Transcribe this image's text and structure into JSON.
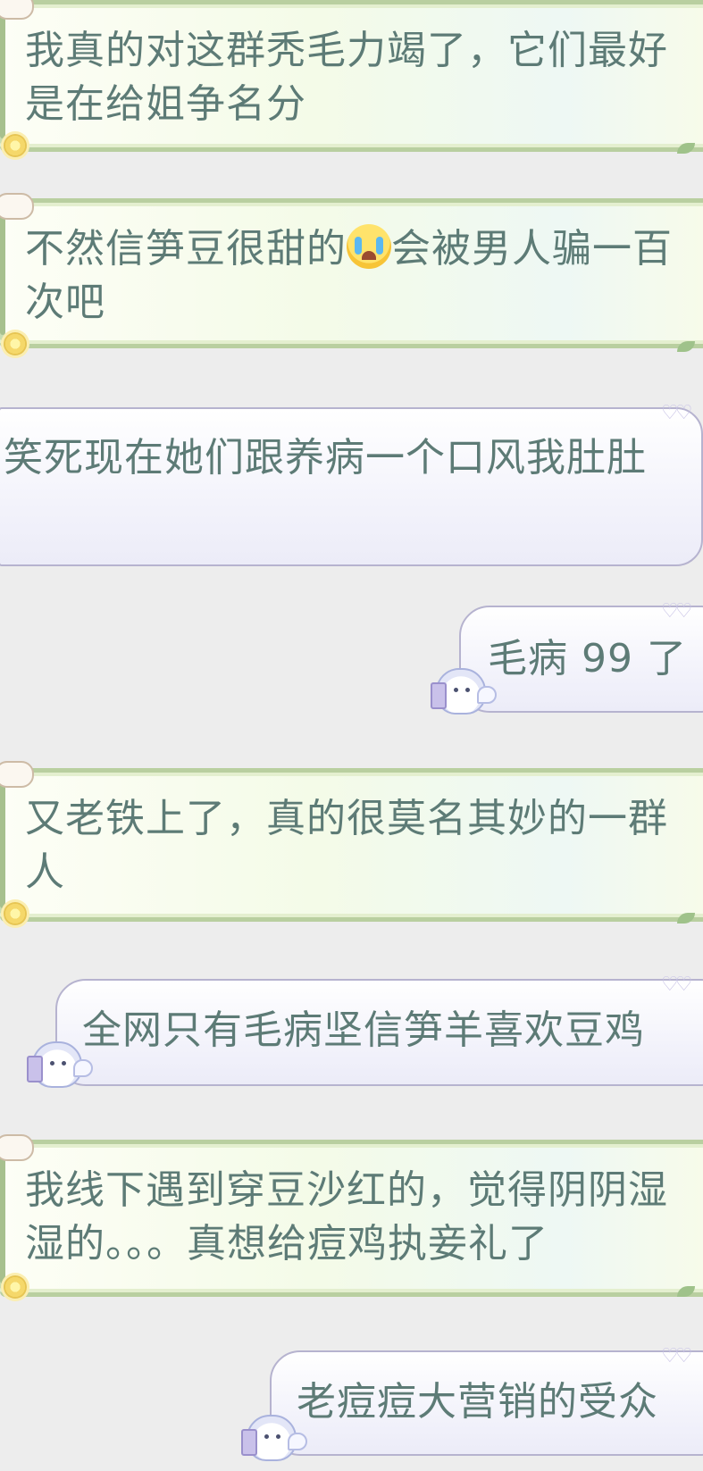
{
  "messages": [
    {
      "side": "left",
      "text": "我真的对这群秃毛力竭了，它们最好是在给姐争名分"
    },
    {
      "side": "left",
      "text_before_emoji": "不然信笋豆很甜的",
      "emoji": "loudly-crying-face",
      "text_after_emoji": "会被男人骗一百次吧"
    },
    {
      "side": "right",
      "text": "笑死现在她们跟养病一个口风我肚肚"
    },
    {
      "side": "right",
      "text": "毛病 99 了"
    },
    {
      "side": "left",
      "text": "又老铁上了，真的很莫名其妙的一群人"
    },
    {
      "side": "right",
      "text": "全网只有毛病坚信笋羊喜欢豆鸡"
    },
    {
      "side": "left",
      "text": "我线下遇到穿豆沙红的，觉得阴阴湿湿的。。。真想给痘鸡执妾礼了"
    },
    {
      "side": "right",
      "text": "老痘痘大营销的受众"
    }
  ],
  "colors": {
    "background": "#ededed",
    "text": "#5d7b76",
    "green_frame": "#b9cfa0",
    "purple_frame": "#b6b3cf"
  }
}
